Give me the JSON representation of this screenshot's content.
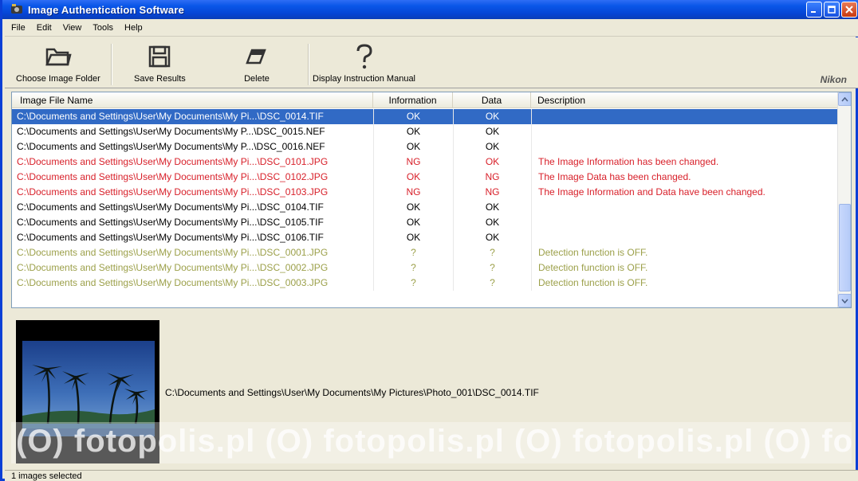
{
  "window": {
    "title": "Image Authentication Software"
  },
  "menu": [
    "File",
    "Edit",
    "View",
    "Tools",
    "Help"
  ],
  "toolbar": {
    "choose_folder": "Choose Image Folder",
    "save_results": "Save Results",
    "delete": "Delete",
    "manual": "Display Instruction Manual",
    "brand": "Nikon"
  },
  "table": {
    "columns": [
      "Image File Name",
      "Information",
      "Data",
      "Description"
    ],
    "rows": [
      {
        "name": "C:\\Documents and Settings\\User\\My Documents\\My Pi...\\DSC_0014.TIF",
        "info": "OK",
        "data": "OK",
        "desc": "",
        "status": "sel"
      },
      {
        "name": "C:\\Documents and Settings\\User\\My Documents\\My P...\\DSC_0015.NEF",
        "info": "OK",
        "data": "OK",
        "desc": "",
        "status": "ok"
      },
      {
        "name": "C:\\Documents and Settings\\User\\My Documents\\My P...\\DSC_0016.NEF",
        "info": "OK",
        "data": "OK",
        "desc": "",
        "status": "ok"
      },
      {
        "name": "C:\\Documents and Settings\\User\\My Documents\\My Pi...\\DSC_0101.JPG",
        "info": "NG",
        "data": "OK",
        "desc": "The Image Information has been changed.",
        "status": "ng"
      },
      {
        "name": "C:\\Documents and Settings\\User\\My Documents\\My Pi...\\DSC_0102.JPG",
        "info": "OK",
        "data": "NG",
        "desc": "The Image Data has been changed.",
        "status": "ng"
      },
      {
        "name": "C:\\Documents and Settings\\User\\My Documents\\My Pi...\\DSC_0103.JPG",
        "info": "NG",
        "data": "NG",
        "desc": "The Image Information and Data have been changed.",
        "status": "ng"
      },
      {
        "name": "C:\\Documents and Settings\\User\\My Documents\\My Pi...\\DSC_0104.TIF",
        "info": "OK",
        "data": "OK",
        "desc": "",
        "status": "ok"
      },
      {
        "name": "C:\\Documents and Settings\\User\\My Documents\\My Pi...\\DSC_0105.TIF",
        "info": "OK",
        "data": "OK",
        "desc": "",
        "status": "ok"
      },
      {
        "name": "C:\\Documents and Settings\\User\\My Documents\\My Pi...\\DSC_0106.TIF",
        "info": "OK",
        "data": "OK",
        "desc": "",
        "status": "ok"
      },
      {
        "name": "C:\\Documents and Settings\\User\\My Documents\\My Pi...\\DSC_0001.JPG",
        "info": "?",
        "data": "?",
        "desc": "Detection function is OFF.",
        "status": "off"
      },
      {
        "name": "C:\\Documents and Settings\\User\\My Documents\\My Pi...\\DSC_0002.JPG",
        "info": "?",
        "data": "?",
        "desc": "Detection function is OFF.",
        "status": "off"
      },
      {
        "name": "C:\\Documents and Settings\\User\\My Documents\\My Pi...\\DSC_0003.JPG",
        "info": "?",
        "data": "?",
        "desc": "Detection function is OFF.",
        "status": "off"
      }
    ]
  },
  "preview": {
    "path": "C:\\Documents and Settings\\User\\My Documents\\My Pictures\\Photo_001\\DSC_0014.TIF"
  },
  "watermark": "fotopolis.pl",
  "status": {
    "text": "1 images selected"
  },
  "icons": {
    "folder": "folder-open-icon",
    "save": "floppy-disk-icon",
    "delete": "eraser-icon",
    "manual": "question-mark-icon"
  },
  "colors": {
    "selection": "#316AC5",
    "ng": "#D8202A",
    "off": "#9CA04A",
    "titlebar": "#0A57E8"
  }
}
